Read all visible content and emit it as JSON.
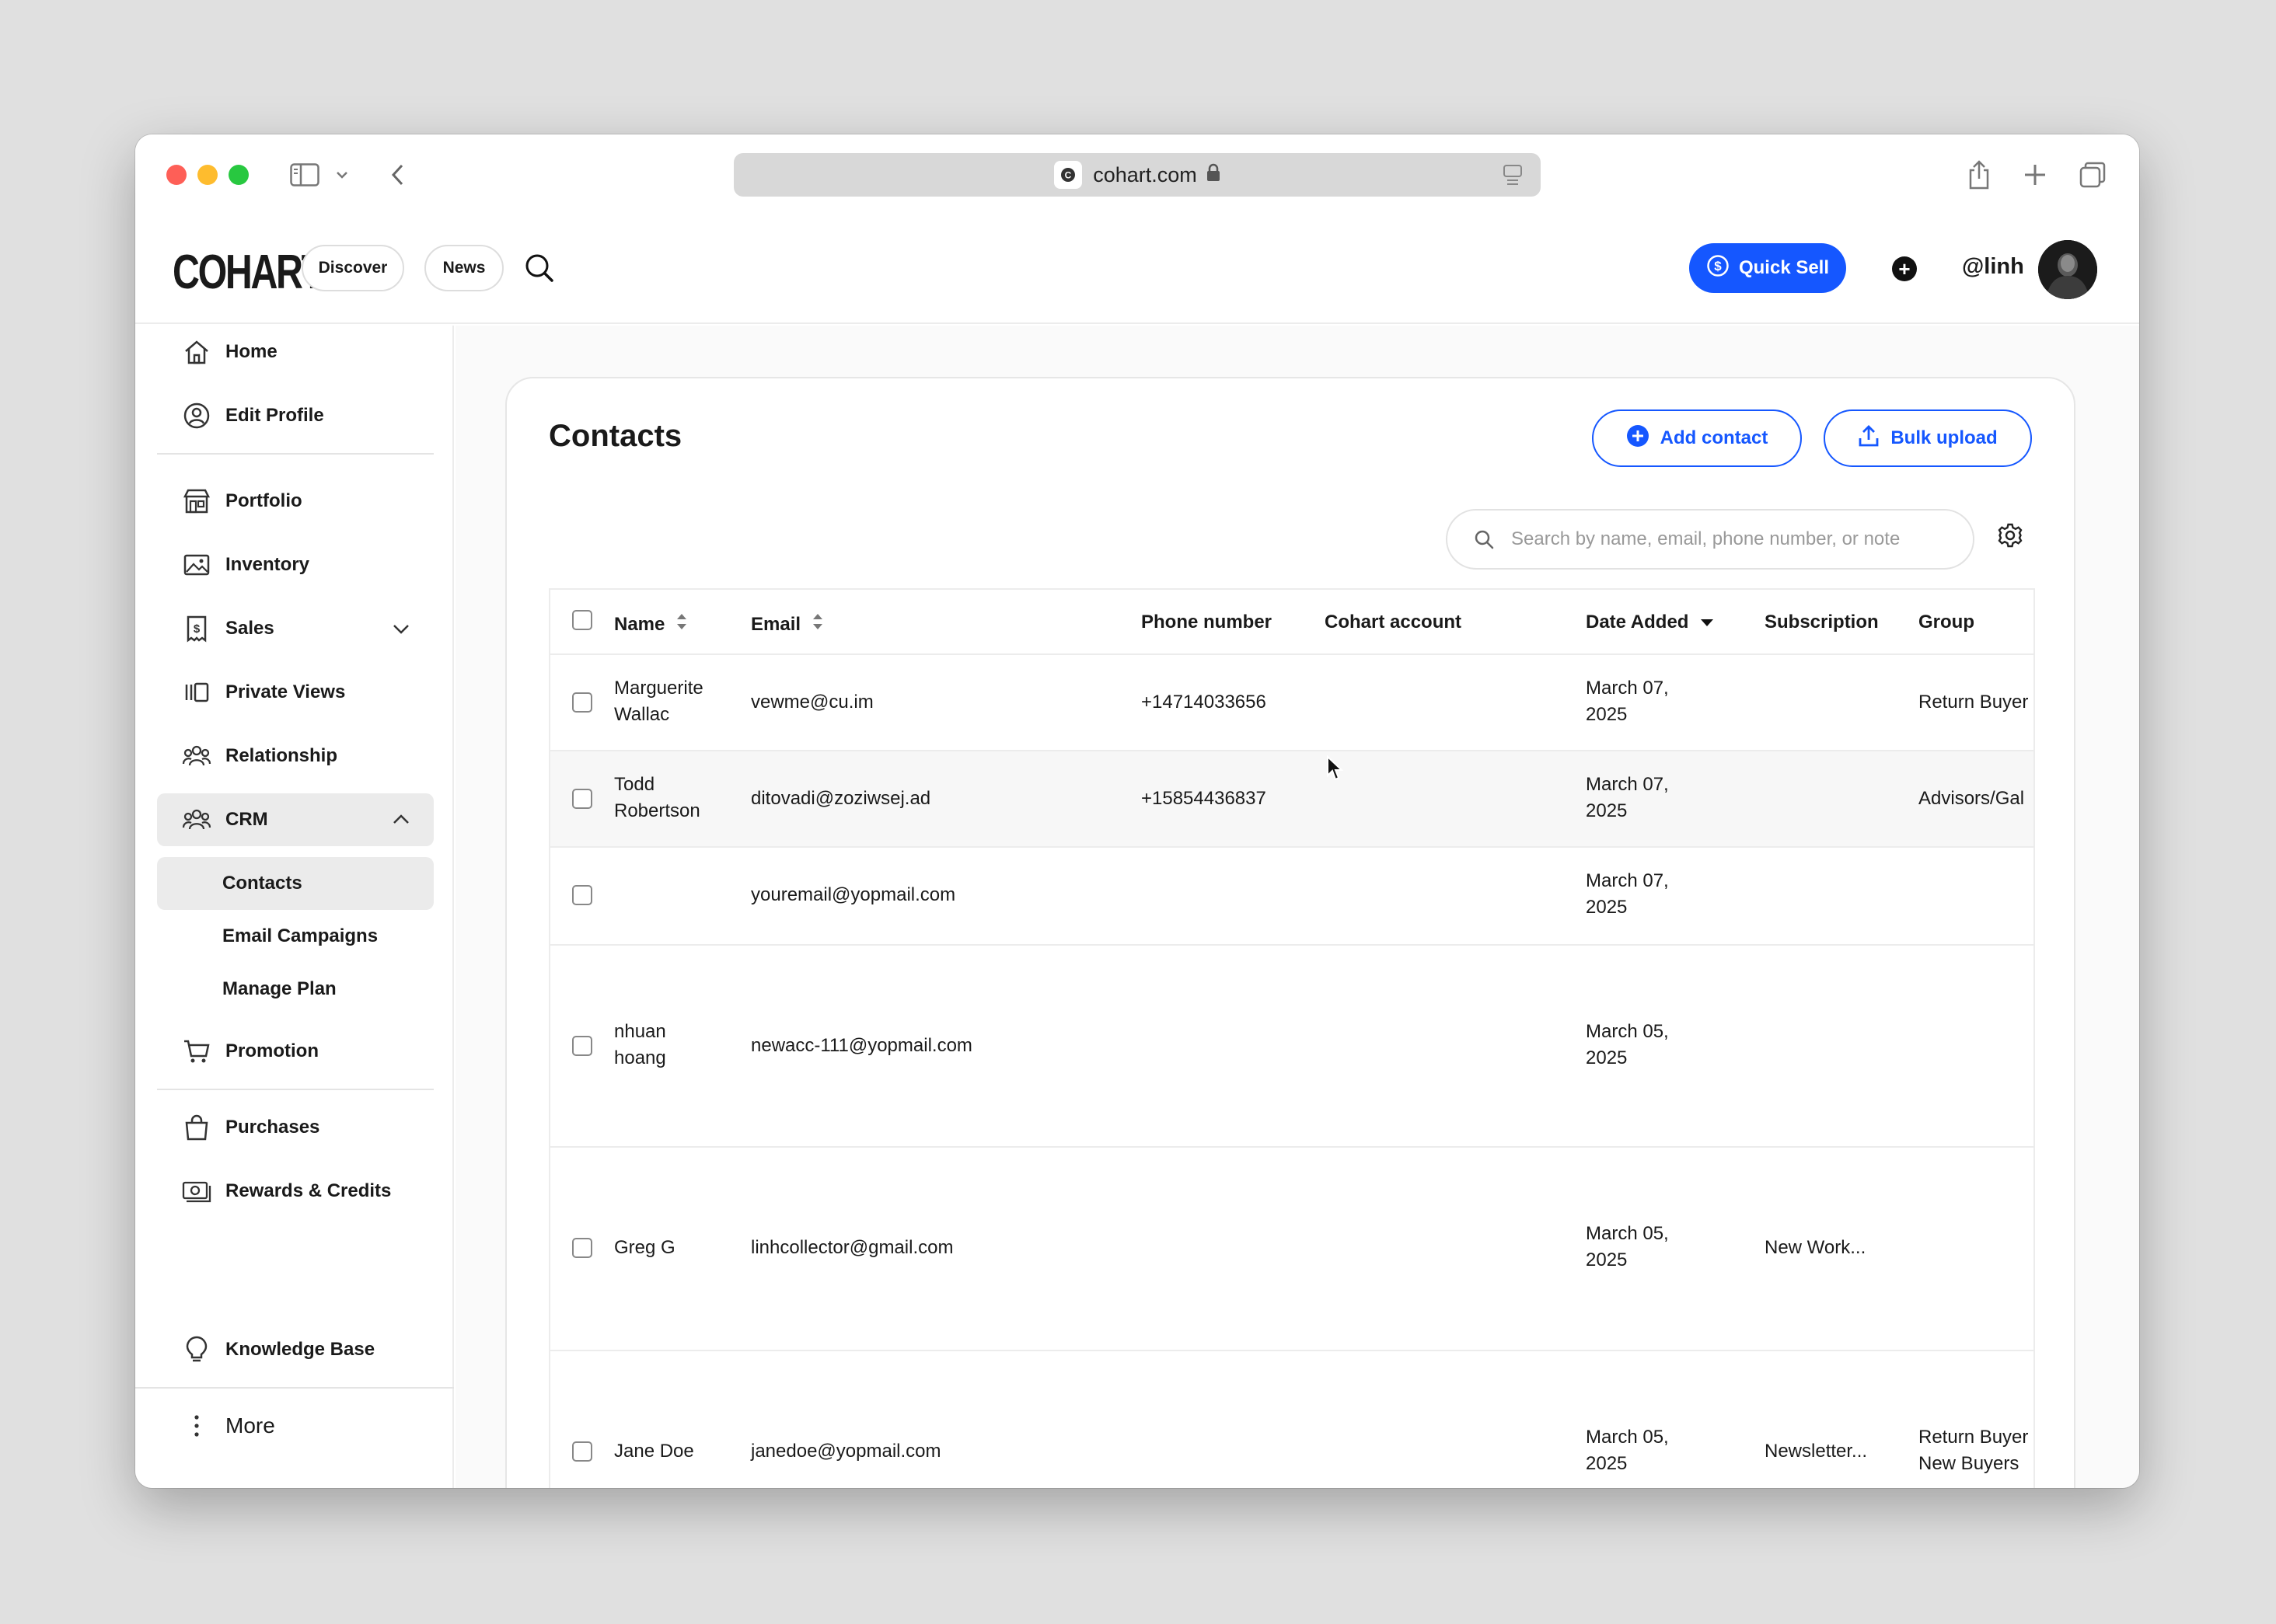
{
  "browser": {
    "url": "cohart.com"
  },
  "header": {
    "logo": "COHART",
    "discover": "Discover",
    "news": "News",
    "quick_sell": "Quick Sell",
    "username": "@linh"
  },
  "sidebar": {
    "home": "Home",
    "edit_profile": "Edit Profile",
    "portfolio": "Portfolio",
    "inventory": "Inventory",
    "sales": "Sales",
    "private_views": "Private Views",
    "relationship": "Relationship",
    "crm": "CRM",
    "contacts": "Contacts",
    "email_campaigns": "Email Campaigns",
    "manage_plan": "Manage Plan",
    "promotion": "Promotion",
    "purchases": "Purchases",
    "rewards": "Rewards & Credits",
    "knowledge_base": "Knowledge Base",
    "more": "More"
  },
  "contacts": {
    "title": "Contacts",
    "add_contact": "Add contact",
    "bulk_upload": "Bulk upload",
    "search_placeholder": "Search by name, email, phone number, or note",
    "columns": {
      "name": "Name",
      "email": "Email",
      "phone": "Phone number",
      "cohart_account": "Cohart account",
      "date_added": "Date Added",
      "subscription": "Subscription",
      "group": "Group"
    },
    "rows": [
      {
        "name_line1": "Marguerite",
        "name_line2": "Wallac",
        "email": "vewme@cu.im",
        "phone": "+14714033656",
        "cohart": "",
        "date_line1": "March 07,",
        "date_line2": "2025",
        "subscription": "",
        "group_line1": "Return Buyer",
        "group_line2": ""
      },
      {
        "name_line1": "Todd",
        "name_line2": "Robertson",
        "email": "ditovadi@zoziwsej.ad",
        "phone": "+15854436837",
        "cohart": "",
        "date_line1": "March 07,",
        "date_line2": "2025",
        "subscription": "",
        "group_line1": "Advisors/Gal",
        "group_line2": ""
      },
      {
        "name_line1": "",
        "name_line2": "",
        "email": "youremail@yopmail.com",
        "phone": "",
        "cohart": "",
        "date_line1": "March 07,",
        "date_line2": "2025",
        "subscription": "",
        "group_line1": "",
        "group_line2": ""
      },
      {
        "name_line1": "nhuan",
        "name_line2": "hoang",
        "email": "newacc-111@yopmail.com",
        "phone": "",
        "cohart": "",
        "date_line1": "March 05,",
        "date_line2": "2025",
        "subscription": "",
        "group_line1": "",
        "group_line2": ""
      },
      {
        "name_line1": "Greg G",
        "name_line2": "",
        "email": "linhcollector@gmail.com",
        "phone": "",
        "cohart": "",
        "date_line1": "March 05,",
        "date_line2": "2025",
        "subscription": "New Work...",
        "group_line1": "",
        "group_line2": ""
      },
      {
        "name_line1": "Jane Doe",
        "name_line2": "",
        "email": "janedoe@yopmail.com",
        "phone": "",
        "cohart": "",
        "date_line1": "March 05,",
        "date_line2": "2025",
        "subscription": "Newsletter...",
        "group_line1": "Return Buyer",
        "group_line2": "New Buyers"
      }
    ]
  },
  "colors": {
    "accent": "#1557ff",
    "selected_bg": "#ebebeb",
    "border": "#ececec"
  }
}
